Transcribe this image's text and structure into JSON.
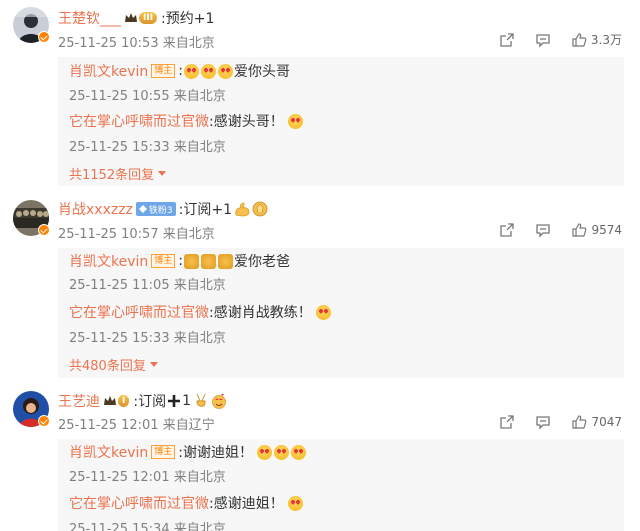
{
  "comments": [
    {
      "username": "王楚钦___",
      "level": "III",
      "text": ":预约+1",
      "meta": "25-11-25 10:53 来自北京",
      "likes": "3.3万",
      "replies": [
        {
          "username": "肖凯文kevin",
          "tag": "博主",
          "text_after": "爱你头哥",
          "prefix": ":",
          "meta": "25-11-25 10:55 来自北京"
        },
        {
          "username": "它在掌心呼啸而过官微",
          "text_after": ":感谢头哥！",
          "meta": "25-11-25 15:33 来自北京"
        }
      ],
      "more_replies": "共1152条回复"
    },
    {
      "username": "肖战xxxzzz",
      "fan_tag": "铁粉3",
      "text": ":订阅+1",
      "meta": "25-11-25 10:57 来自北京",
      "likes": "9574",
      "replies": [
        {
          "username": "肖凯文kevin",
          "tag": "博主",
          "prefix": ":",
          "text_after": "爱你老爸",
          "meta": "25-11-25 11:05 来自北京"
        },
        {
          "username": "它在掌心呼啸而过官微",
          "text_after": ":感谢肖战教练！",
          "meta": "25-11-25 15:33 来自北京"
        }
      ],
      "more_replies": "共480条回复"
    },
    {
      "username": "王艺迪",
      "level": "I",
      "text": ":订阅",
      "text_tail": "1",
      "meta": "25-11-25 12:01 来自辽宁",
      "likes": "7047",
      "replies": [
        {
          "username": "肖凯文kevin",
          "tag": "博主",
          "text_after": ":谢谢迪姐！",
          "meta": "25-11-25 12:01 来自北京"
        },
        {
          "username": "它在掌心呼啸而过官微",
          "text_after": ":感谢迪姐！",
          "meta": "25-11-25 15:34 来自北京"
        }
      ]
    }
  ],
  "icons": {
    "share": "share-icon",
    "comment": "comment-icon",
    "like": "thumbs-up-icon"
  },
  "colors": {
    "username": "#eb7350",
    "meta": "#808080",
    "reply_bg": "#f7f7f7",
    "badge": "#ff8200"
  }
}
